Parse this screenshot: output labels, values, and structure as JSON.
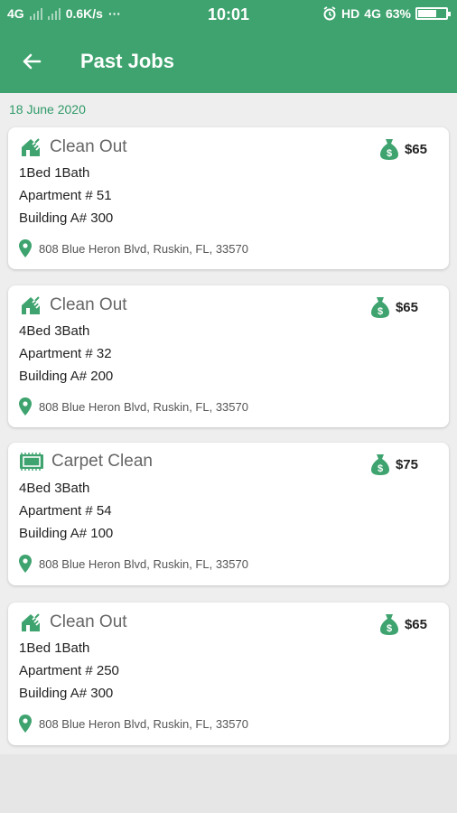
{
  "status_bar": {
    "network_left": "4G",
    "speed": "0.6K/s",
    "dots": "···",
    "time": "10:01",
    "hd": "HD",
    "network_right": "4G",
    "battery_percent": "63%",
    "battery_level": 0.63
  },
  "app_bar": {
    "title": "Past Jobs"
  },
  "date_header": "18 June 2020",
  "jobs": [
    {
      "title": "Clean Out",
      "price": "$65",
      "rooms": "1Bed 1Bath",
      "apartment": "Apartment # 51",
      "building": "Building A# 300",
      "address": "808 Blue Heron Blvd, Ruskin, FL, 33570",
      "icon": "house-clean-icon"
    },
    {
      "title": "Clean Out",
      "price": "$65",
      "rooms": "4Bed 3Bath",
      "apartment": "Apartment # 32",
      "building": "Building A# 200",
      "address": "808 Blue Heron Blvd, Ruskin, FL, 33570",
      "icon": "house-clean-icon"
    },
    {
      "title": "Carpet Clean",
      "price": "$75",
      "rooms": "4Bed 3Bath",
      "apartment": "Apartment # 54",
      "building": "Building A# 100",
      "address": "808 Blue Heron Blvd, Ruskin, FL, 33570",
      "icon": "carpet-icon"
    },
    {
      "title": "Clean Out",
      "price": "$65",
      "rooms": "1Bed 1Bath",
      "apartment": "Apartment # 250",
      "building": "Building A# 300",
      "address": "808 Blue Heron Blvd, Ruskin, FL, 33570",
      "icon": "house-clean-icon"
    }
  ],
  "colors": {
    "primary": "#3ea36e",
    "accent": "#2f9a68",
    "background": "#eeeeee"
  }
}
